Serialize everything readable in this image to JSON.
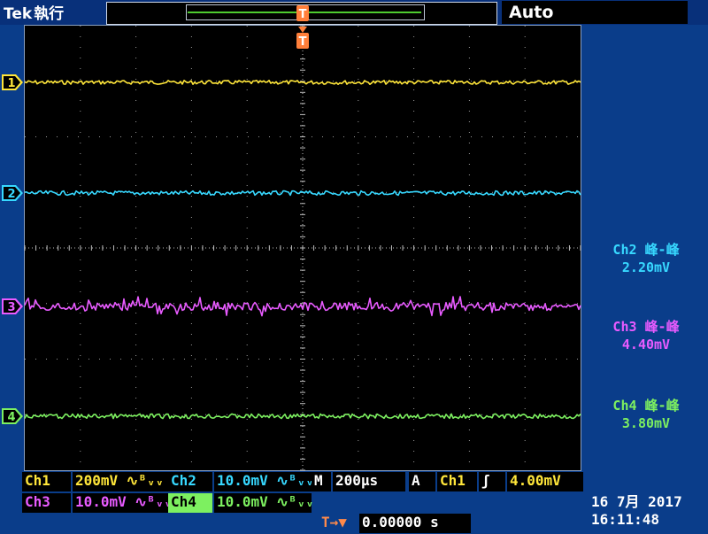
{
  "header": {
    "brand": "Tek",
    "run_state": "執行",
    "trigger_mode": "Auto"
  },
  "trigger_marker": "T",
  "channels": [
    {
      "id": "1",
      "color": "#ffe63a"
    },
    {
      "id": "2",
      "color": "#37d8ff"
    },
    {
      "id": "3",
      "color": "#e85bff"
    },
    {
      "id": "4",
      "color": "#7df060"
    }
  ],
  "measurements": [
    {
      "title": "Ch2 峰-峰",
      "value": "2.20mV",
      "color": "#37d8ff"
    },
    {
      "title": "Ch3 峰-峰",
      "value": "4.40mV",
      "color": "#e85bff"
    },
    {
      "title": "Ch4 峰-峰",
      "value": "3.80mV",
      "color": "#7df060"
    }
  ],
  "readout": {
    "ch1_label": "Ch1",
    "ch1_scale": "200mV ∿ᴮᵥᵥ",
    "ch2_label": "Ch2",
    "ch2_scale": "10.0mV ∿ᴮᵥᵥ",
    "ch3_label": "Ch3",
    "ch3_scale": "10.0mV ∿ᴮᵥᵥ",
    "ch4_label": "Ch4",
    "ch4_scale": "10.0mV ∿ᴮᵥᵥ",
    "timebase_label": "M",
    "timebase": "200µs",
    "trigger_label": "A",
    "trigger_source": "Ch1",
    "trigger_slope": "ʃ",
    "trigger_level": "4.00mV",
    "position_prefix": "T→▼",
    "position": "0.00000 s"
  },
  "datetime": {
    "date": "16 7月  2017",
    "time": "16:11:48"
  }
}
